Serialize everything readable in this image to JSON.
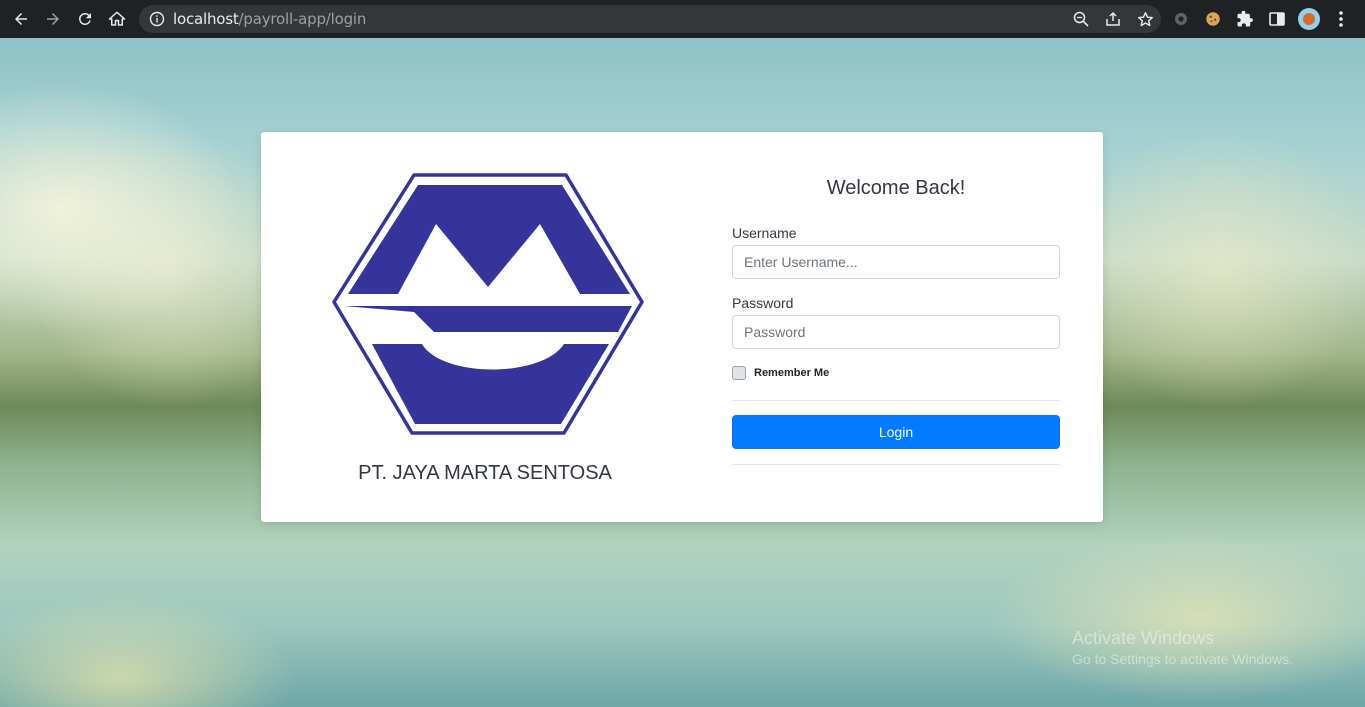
{
  "browser": {
    "url_host": "localhost",
    "url_path": "/payroll-app/login"
  },
  "company": {
    "name": "PT. JAYA MARTA SENTOSA",
    "logo_color": "#35349a"
  },
  "form": {
    "title": "Welcome Back!",
    "username_label": "Username",
    "username_placeholder": "Enter Username...",
    "password_label": "Password",
    "password_placeholder": "Password",
    "remember_label": "Remember Me",
    "login_label": "Login",
    "accent": "#007bff"
  },
  "watermark": {
    "line1": "Activate Windows",
    "line2": "Go to Settings to activate Windows."
  }
}
